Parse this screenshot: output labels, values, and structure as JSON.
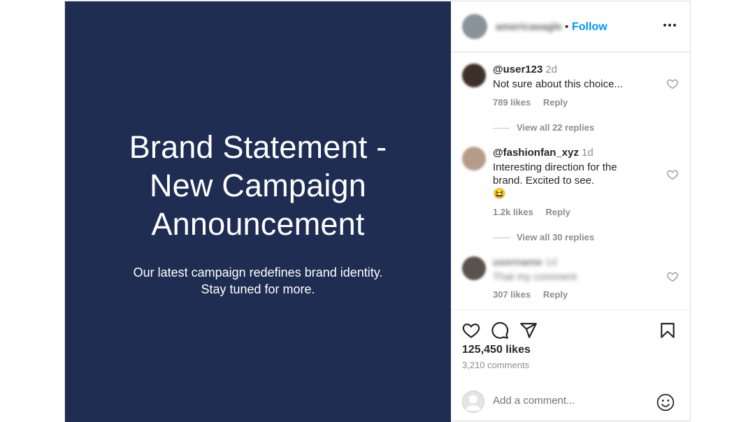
{
  "media": {
    "title": "Brand Statement -\nNew Campaign\nAnnouncement",
    "subtitle": "Our latest campaign redefines brand identity.\nStay tuned for more.",
    "background_color": "#1f2d53"
  },
  "header": {
    "username": "americaeagle",
    "separator": "•",
    "follow_label": "Follow",
    "more_icon": "more-horizontal-icon"
  },
  "comments": [
    {
      "username": "@user123",
      "time": "2d",
      "text": "Not sure about this choice...",
      "likes": "789 likes",
      "reply_label": "Reply",
      "view_replies": "View all 22 replies"
    },
    {
      "username": "@fashionfan_xyz",
      "time": "1d",
      "text": "Interesting direction for the\nbrand. Excited to see.\n😆",
      "likes": "1.2k likes",
      "reply_label": "Reply",
      "view_replies": "View all 30 replies"
    },
    {
      "username": "username",
      "time": "1d",
      "text": "That my comment",
      "likes": "307 likes",
      "reply_label": "Reply",
      "blurred": true
    }
  ],
  "actions": {
    "icons": [
      "heart-icon",
      "comment-icon",
      "share-icon",
      "bookmark-icon"
    ],
    "likes": "125,450 likes",
    "comments_count": "3,210 comments"
  },
  "add_comment": {
    "placeholder": "Add a comment...",
    "emoji_icon": "emoji-icon"
  },
  "colors": {
    "accent": "#0095f6",
    "text": "#262626",
    "muted": "#8e8e8e",
    "border": "#dbdbdb"
  }
}
